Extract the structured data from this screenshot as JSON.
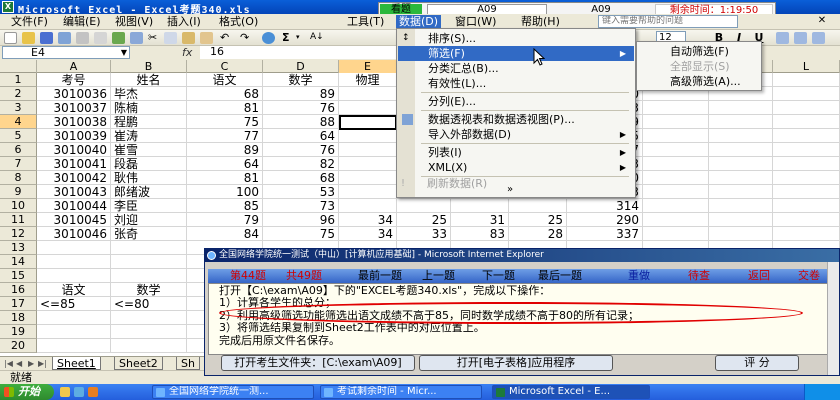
{
  "window": {
    "title": "Microsoft Excel - Excel考题340.xls"
  },
  "exam_timer": {
    "label": "看题",
    "code": "A09",
    "code_display": "A09",
    "remaining_label": "剩余时间",
    "remaining_time": "1:19:50"
  },
  "menubar": {
    "items": [
      "文件(F)",
      "编辑(E)",
      "视图(V)",
      "插入(I)",
      "格式(O)",
      "工具(T)",
      "数据(D)",
      "窗口(W)",
      "帮助(H)"
    ],
    "help_placeholder": "键入需要帮助的问题"
  },
  "toolbar": {
    "font_size": "12",
    "bold": "B",
    "italic": "I",
    "underline": "U"
  },
  "formula_bar": {
    "name_box": "E4",
    "fx": "fx",
    "value": "16"
  },
  "sheet": {
    "columns": [
      "A",
      "B",
      "C",
      "D",
      "E",
      "F",
      "G",
      "H",
      "I",
      "J",
      "K",
      "L",
      "M"
    ],
    "row_numbers": [
      "1",
      "2",
      "3",
      "4",
      "5",
      "6",
      "7",
      "8",
      "9",
      "10",
      "11",
      "12",
      "13",
      "14",
      "15",
      "16",
      "17",
      "18",
      "19",
      "20"
    ],
    "header": [
      "考号",
      "姓名",
      "语文",
      "数学",
      "物理"
    ],
    "rows": [
      [
        "3010036",
        "毕杰",
        "68",
        "89",
        "",
        "",
        "",
        "260"
      ],
      [
        "3010037",
        "陈楠",
        "81",
        "76",
        "",
        "",
        "",
        "323"
      ],
      [
        "3010038",
        "程鹏",
        "75",
        "88",
        "",
        "",
        "",
        "279"
      ],
      [
        "3010039",
        "崔涛",
        "77",
        "64",
        "",
        "",
        "",
        "305"
      ],
      [
        "3010040",
        "崔雪",
        "89",
        "76",
        "",
        "",
        "",
        "277"
      ],
      [
        "3010041",
        "段磊",
        "64",
        "82",
        "",
        "",
        "",
        "273"
      ],
      [
        "3010042",
        "耿伟",
        "81",
        "68",
        "",
        "",
        "",
        "250"
      ],
      [
        "3010043",
        "郎绪波",
        "100",
        "53",
        "",
        "",
        "",
        "343"
      ],
      [
        "3010044",
        "李臣",
        "85",
        "73",
        "",
        "",
        "",
        "314"
      ],
      [
        "3010045",
        "刘迎",
        "79",
        "96",
        "34",
        "25",
        "31",
        "25",
        "290"
      ],
      [
        "3010046",
        "张奇",
        "84",
        "75",
        "34",
        "33",
        "83",
        "28",
        "337"
      ]
    ],
    "criteria": {
      "h1": "语文",
      "h2": "数学",
      "c1": "<=85",
      "c2": "<=80"
    },
    "tabs": [
      "Sheet1",
      "Sheet2",
      "Sh"
    ]
  },
  "status": "就绪",
  "data_menu": {
    "items": [
      {
        "label": "排序(S)...",
        "submenu": false
      },
      {
        "label": "筛选(F)",
        "submenu": true,
        "highlighted": true
      },
      {
        "label": "分类汇总(B)...",
        "submenu": false
      },
      {
        "label": "有效性(L)...",
        "submenu": false
      },
      {
        "label": "分列(E)...",
        "submenu": false
      },
      {
        "label": "数据透视表和数据透视图(P)...",
        "submenu": false
      },
      {
        "label": "导入外部数据(D)",
        "submenu": true
      },
      {
        "label": "列表(I)",
        "submenu": true
      },
      {
        "label": "XML(X)",
        "submenu": true
      },
      {
        "label": "刷新数据(R)",
        "submenu": false,
        "disabled": true
      }
    ],
    "more": "»"
  },
  "filter_menu": {
    "items": [
      {
        "label": "自动筛选(F)",
        "disabled": false
      },
      {
        "label": "全部显示(S)",
        "disabled": true
      },
      {
        "label": "高级筛选(A)...",
        "disabled": false
      }
    ]
  },
  "exam_window": {
    "title": "全国网络学院统一测试（中山）[计算机应用基础] - Microsoft Internet Explorer",
    "nav": {
      "question_index": "第44题",
      "question_total": "共49题",
      "first": "最前一题",
      "prev": "上一题",
      "next": "下一题",
      "last": "最后一题",
      "redo": "重做",
      "wait": "待查",
      "back": "返回",
      "submit": "交卷"
    },
    "instructions": [
      "打开【C:\\exam\\A09】下的\"EXCEL考题340.xls\"，完成以下操作：",
      "1）计算各学生的总分；",
      "2）利用高级筛选功能筛选出语文成绩不高于85，同时数学成绩不高于80的所有记录；",
      "3）将筛选结果复制到Sheet2工作表中的对应位置上。",
      "完成后用原文件名保存。"
    ],
    "buttons": {
      "open_folder": "打开考生文件夹：[C:\\exam\\A09]",
      "open_app": "打开[电子表格]应用程序",
      "grade": "评  分"
    }
  },
  "taskbar": {
    "start": "开始",
    "tasks": [
      "全国网络学院统一测...",
      "考试剩余时间 - Micr...",
      "Microsoft Excel - E..."
    ]
  },
  "colors": {
    "title_bar": "#0344b8",
    "menu_highlight": "#316ac5",
    "exam_nav": "#3565c7",
    "oval": "#e00000",
    "timer_remaining": "#d00000"
  }
}
